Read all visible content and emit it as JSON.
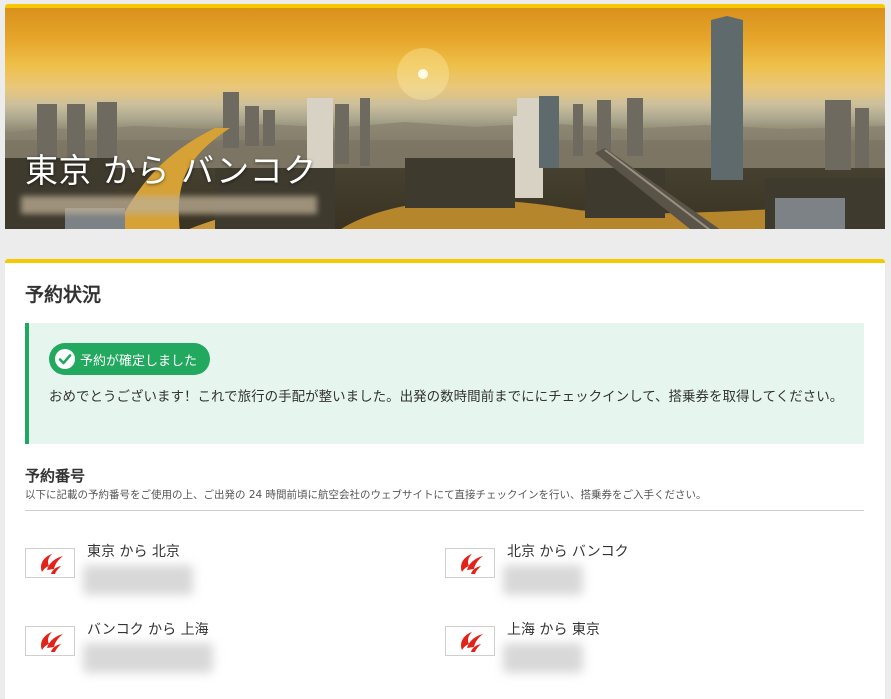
{
  "hero": {
    "title": "東京 から バンコク",
    "subtitle_redacted": true
  },
  "status_section": {
    "title": "予約状況",
    "badge_label": "予約が確定しました",
    "badge_icon": "check-icon",
    "message": "おめでとうございます！これで旅行の手配が整いました。出発の数時間前までににチェックインして、搭乗券を取得してください。"
  },
  "booking_number": {
    "heading": "予約番号",
    "description": "以下に記載の予約番号をご使用の上、ご出発の 24 時間前頃に航空会社のウェブサイトにて直接チェックインを行い、搭乗券をご入手ください。"
  },
  "flights": [
    {
      "route": "東京 から 北京",
      "airline_logo": "air-china-phoenix-logo",
      "code_redacted": true
    },
    {
      "route": "北京 から バンコク",
      "airline_logo": "air-china-phoenix-logo",
      "code_redacted": true
    },
    {
      "route": "バンコク から 上海",
      "airline_logo": "air-china-phoenix-logo",
      "code_redacted": true
    },
    {
      "route": "上海 から 東京",
      "airline_logo": "air-china-phoenix-logo",
      "code_redacted": true
    }
  ],
  "colors": {
    "accent_yellow": "#f5c800",
    "success_green": "#22a95f",
    "alert_bg": "#e6f6ee",
    "airline_red": "#e2231a"
  }
}
